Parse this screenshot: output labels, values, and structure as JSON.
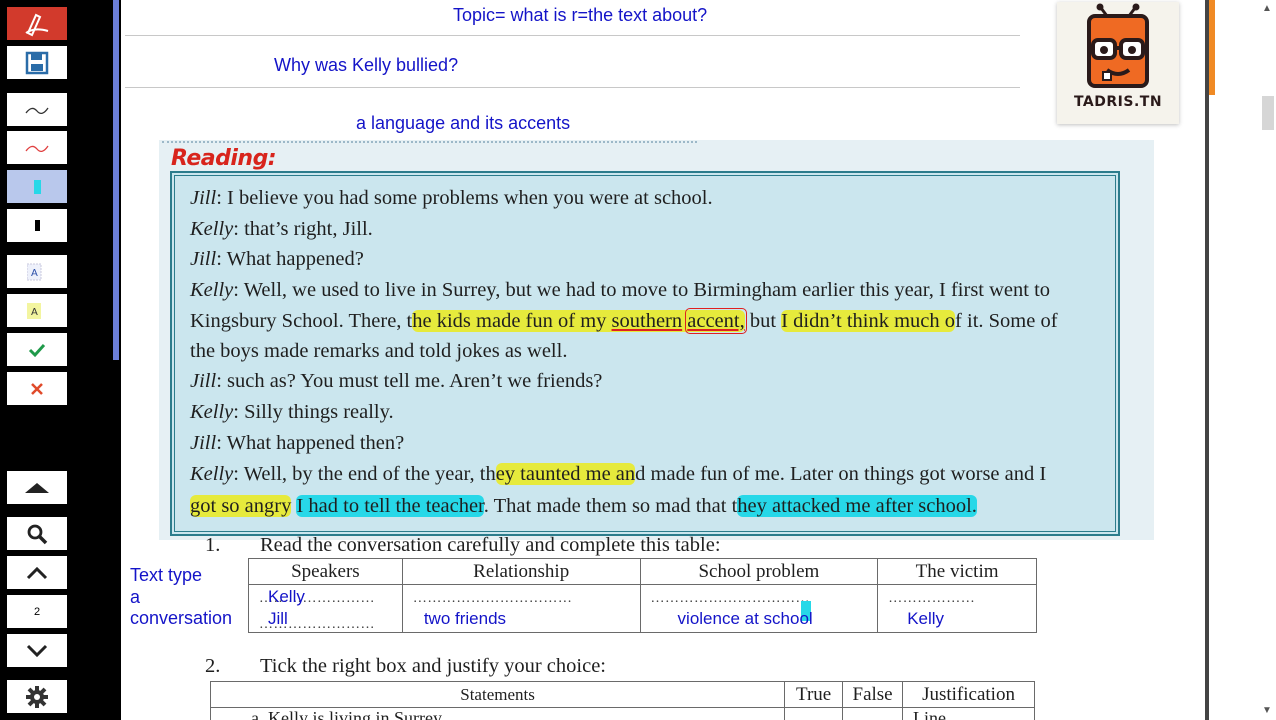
{
  "toolbar": {
    "page_number": "2"
  },
  "annotations": {
    "topic": "Topic= what is r=the text about?",
    "question": "Why was Kelly bullied?",
    "answer": "a language and its accents",
    "text_type": "Text type",
    "text_type_a": "a",
    "text_type_value": "conversation"
  },
  "reading": {
    "title": "Reading:",
    "l1_sp": "Jill",
    "l1": ": I believe you had some problems when you were at school.",
    "l2_sp": "Kelly",
    "l2": ": that’s right, Jill.",
    "l3_sp": "Jill",
    "l3": ": What happened?",
    "l4_sp": "Kelly",
    "l4": ": Well, we used to live in Surrey, but we had to move to Birmingham earlier this year, I first went to",
    "l5_a": "Kingsbury School. There, t",
    "l5_b": "he kids made fun of my",
    "l5_c": " ",
    "l5_d": "southern",
    "l5_e": " ",
    "l5_f": "accent,",
    "l5_g": " but ",
    "l5_h": "I didn’t think much o",
    "l5_i": "f it. Some of",
    "l6": "the boys made remarks and told jokes as well.",
    "l7_sp": "Jill",
    "l7": ": such as? You must tell me. Aren’t we friends?",
    "l8_sp": "Kelly",
    "l8": ": Silly things really.",
    "l9_sp": "Jill",
    "l9": ": What happened then?",
    "l10_sp": "Kelly",
    "l10_a": ": Well, by the end of the year, th",
    "l10_b": "ey taunted me an",
    "l10_c": "d made fun of me. Later on things got worse and I",
    "l11_a": "got so angry",
    "l11_b": " ",
    "l11_c": "I had to tell the teacher",
    "l11_d": ". That made them so mad that t",
    "l11_e": "hey attacked me after school.",
    "l11_f": ""
  },
  "task1": {
    "number": "1.",
    "instruction": "Read the conversation carefully and complete this table:",
    "headers": [
      "Speakers",
      "Relationship",
      "School problem",
      "The victim"
    ],
    "dots_short": "……………………",
    "dots_long": "……………………………",
    "dots_mid": "……………………………",
    "dots_victim": "………………",
    "answers": {
      "speaker1": "Kelly",
      "speaker2": "Jill",
      "relationship": "two friends",
      "problem": "violence at school",
      "victim": "Kelly"
    }
  },
  "task2": {
    "number": "2.",
    "instruction": "Tick the right box and justify your choice:",
    "headers": [
      "Statements",
      "True",
      "False",
      "Justification"
    ],
    "row1_statement": "a.    Kelly is living in Surrey.",
    "row1_justification": "Line"
  },
  "logo": {
    "text": "TADRIS.TN"
  },
  "colors": {
    "highlight_yellow": "#e6ea3c",
    "highlight_cyan": "#27d8e8",
    "handwriting_blue": "#1414c8",
    "reading_red": "#d8241c"
  }
}
